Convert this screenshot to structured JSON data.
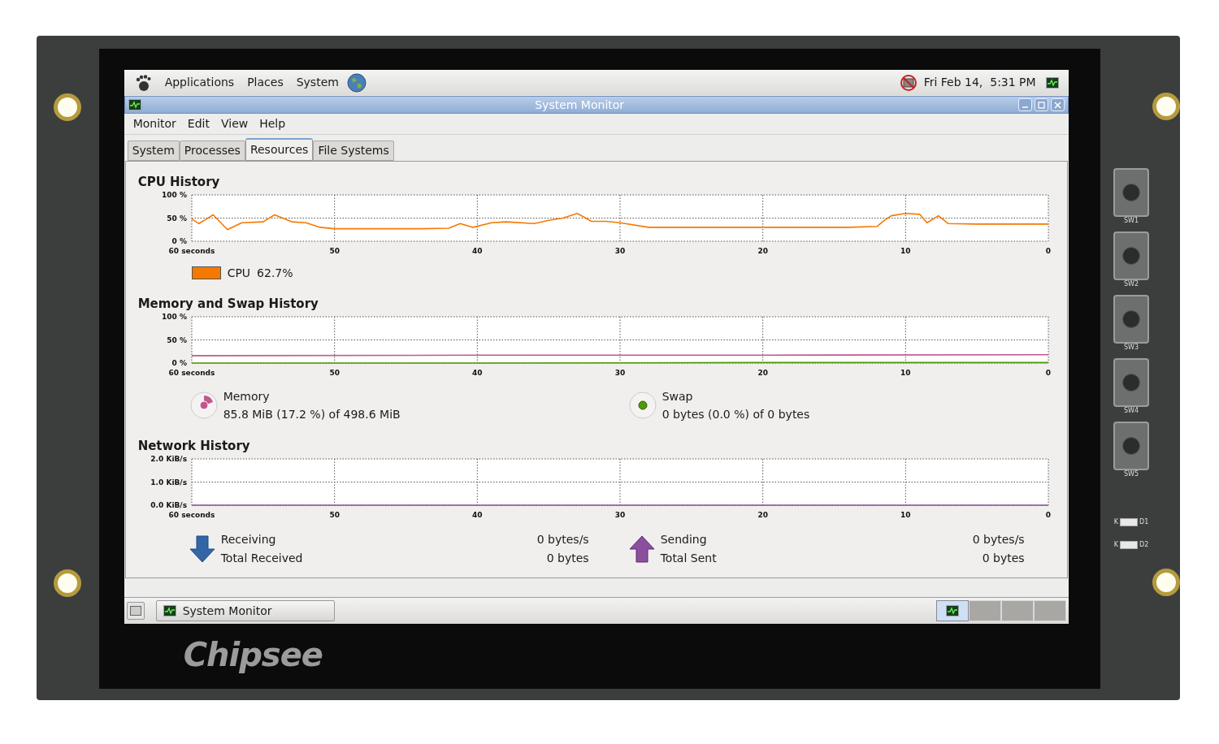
{
  "device": {
    "logo": "Chipsee",
    "switches": [
      {
        "label": "SW1",
        "pressed": false
      },
      {
        "label": "SW2",
        "pressed": false
      },
      {
        "label": "SW3",
        "pressed": false
      },
      {
        "label": "SW4",
        "pressed": false
      },
      {
        "label": "SW5",
        "pressed": false
      }
    ],
    "leds": [
      {
        "cathode": "K",
        "label": "D1"
      },
      {
        "cathode": "K",
        "label": "D2"
      }
    ]
  },
  "top_panel": {
    "menus": [
      "Applications",
      "Places",
      "System"
    ],
    "clock": "Fri Feb 14,  5:31 PM"
  },
  "window": {
    "title": "System Monitor",
    "menu": [
      "Monitor",
      "Edit",
      "View",
      "Help"
    ],
    "tabs": [
      {
        "label": "System",
        "selected": false
      },
      {
        "label": "Processes",
        "selected": false
      },
      {
        "label": "Resources",
        "selected": true
      },
      {
        "label": "File Systems",
        "selected": false
      }
    ]
  },
  "cpu": {
    "title": "CPU History",
    "legend": {
      "value": "62.7%"
    },
    "chart_data": {
      "type": "line",
      "grid": true,
      "x": [
        60,
        59.5,
        58.5,
        57.5,
        56.5,
        55,
        54.2,
        53,
        52,
        51,
        50,
        48,
        46,
        44,
        42,
        41.2,
        40.3,
        39,
        38,
        36,
        35,
        34,
        33,
        32,
        31,
        30,
        28,
        26,
        24,
        22,
        20,
        18,
        16,
        14,
        12,
        11.5,
        11,
        10,
        9,
        8.5,
        7.7,
        7,
        5,
        3,
        1,
        0
      ],
      "series": [
        {
          "name": "CPU",
          "color": "#f57900",
          "values": [
            48,
            38,
            57,
            25,
            40,
            42,
            57,
            42,
            40,
            30,
            27,
            27,
            27,
            27,
            28,
            38,
            30,
            40,
            42,
            38,
            45,
            50,
            60,
            43,
            43,
            40,
            30,
            30,
            30,
            30,
            30,
            30,
            30,
            30,
            32,
            45,
            55,
            60,
            58,
            40,
            55,
            38,
            37,
            37,
            37,
            37
          ]
        }
      ],
      "xlim": [
        60,
        0
      ],
      "ylim": [
        0,
        100
      ],
      "xticks": [
        {
          "value": 60,
          "label": "60 seconds"
        },
        {
          "value": 50,
          "label": "50"
        },
        {
          "value": 40,
          "label": "40"
        },
        {
          "value": 30,
          "label": "30"
        },
        {
          "value": 20,
          "label": "20"
        },
        {
          "value": 10,
          "label": "10"
        },
        {
          "value": 0,
          "label": "0"
        }
      ],
      "yticks": [
        {
          "value": 0,
          "label": "0 %"
        },
        {
          "value": 50,
          "label": "50 %"
        },
        {
          "value": 100,
          "label": "100 %"
        }
      ]
    }
  },
  "memory": {
    "title": "Memory and Swap History",
    "memory": {
      "value": "85.8 MiB (17.2 %) of 498.6 MiB"
    },
    "swap": {
      "value": "0 bytes (0.0 %) of 0 bytes"
    },
    "chart_data": {
      "type": "line",
      "grid": true,
      "x": [
        60,
        40,
        20,
        0
      ],
      "series": [
        {
          "name": "Memory",
          "color": "#c1578f",
          "values": [
            16,
            17,
            17,
            18
          ]
        },
        {
          "name": "Swap",
          "color": "#4e9a06",
          "values": [
            0,
            0,
            1,
            1
          ]
        }
      ],
      "xlim": [
        60,
        0
      ],
      "ylim": [
        0,
        100
      ],
      "xticks": [
        {
          "value": 60,
          "label": "60 seconds"
        },
        {
          "value": 50,
          "label": "50"
        },
        {
          "value": 40,
          "label": "40"
        },
        {
          "value": 30,
          "label": "30"
        },
        {
          "value": 20,
          "label": "20"
        },
        {
          "value": 10,
          "label": "10"
        },
        {
          "value": 0,
          "label": "0"
        }
      ],
      "yticks": [
        {
          "value": 0,
          "label": "0 %"
        },
        {
          "value": 50,
          "label": "50 %"
        },
        {
          "value": 100,
          "label": "100 %"
        }
      ]
    }
  },
  "network": {
    "title": "Network History",
    "receiving": {
      "rate": "0 bytes/s",
      "total_label": "Total Received",
      "total": "0 bytes"
    },
    "sending": {
      "rate": "0 bytes/s",
      "total_label": "Total Sent",
      "total": "0 bytes"
    },
    "chart_data": {
      "type": "line",
      "grid": true,
      "x": [
        60,
        0
      ],
      "series": [
        {
          "name": "Receiving",
          "color": "#3465a4",
          "values": [
            null,
            null
          ]
        },
        {
          "name": "Sending",
          "color": "#8b4f9e",
          "values": [
            0,
            0
          ]
        }
      ],
      "xlim": [
        60,
        0
      ],
      "ylim": [
        0,
        2
      ],
      "xticks": [
        {
          "value": 60,
          "label": "60 seconds"
        },
        {
          "value": 50,
          "label": "50"
        },
        {
          "value": 40,
          "label": "40"
        },
        {
          "value": 30,
          "label": "30"
        },
        {
          "value": 20,
          "label": "20"
        },
        {
          "value": 10,
          "label": "10"
        },
        {
          "value": 0,
          "label": "0"
        }
      ],
      "yticks": [
        {
          "value": 0,
          "label": "0.0 KiB/s"
        },
        {
          "value": 1,
          "label": "1.0 KiB/s"
        },
        {
          "value": 2,
          "label": "2.0 KiB/s"
        }
      ]
    }
  },
  "taskbar": {
    "tasks": [
      {
        "label": "System Monitor",
        "selected": false
      }
    ],
    "workspaces": [
      {
        "selected": true
      },
      {
        "selected": false
      },
      {
        "selected": false
      },
      {
        "selected": false
      }
    ]
  }
}
